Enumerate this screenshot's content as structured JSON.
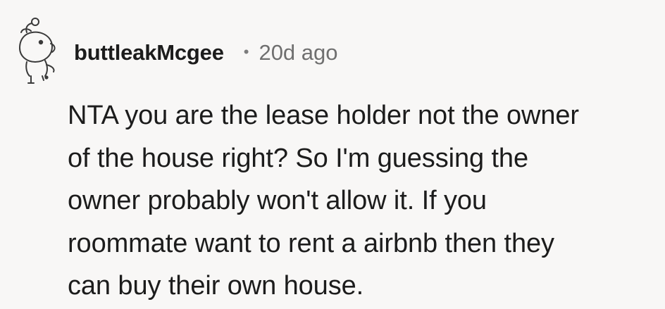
{
  "comment": {
    "author": "buttleakMcgee",
    "separator": "•",
    "timestamp": "20d ago",
    "avatar_icon": "snoo-avatar-icon",
    "body_lines": [
      "NTA you are the lease holder not the owner",
      "of the house right? So I'm guessing the",
      "owner probably won't allow it. If you",
      "roommate want to rent a airbnb then they",
      "can buy their own house."
    ]
  }
}
